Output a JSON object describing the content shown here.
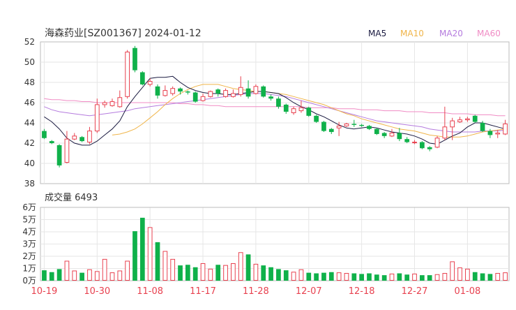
{
  "title": "海森药业[SZ001367] 2024-01-12",
  "colors": {
    "up": "#e8414f",
    "down": "#0fb14a",
    "ma5": "#1a1a40",
    "ma10": "#f0b54a",
    "ma20": "#b57bde",
    "ma60": "#f08bc4",
    "grid": "#e6e6e6",
    "frame": "#bbbbbb",
    "axis_text": "#333333",
    "date_text": "#e8414f"
  },
  "legend": {
    "ma5": "MA5",
    "ma10": "MA10",
    "ma20": "MA20",
    "ma60": "MA60"
  },
  "volume_label": "成交量 6493",
  "chart_data": [
    {
      "type": "candlestick",
      "title": "海森药业[SZ001367] 2024-01-12",
      "y_ticks": [
        52,
        50,
        48,
        46,
        44,
        42,
        40,
        38
      ],
      "ylim": [
        38,
        52
      ],
      "x_tick_labels": [
        "10-19",
        "10-30",
        "11-08",
        "11-17",
        "11-28",
        "12-07",
        "12-18",
        "12-27",
        "01-08"
      ],
      "x_tick_indices": [
        0,
        7,
        14,
        21,
        28,
        35,
        42,
        49,
        56
      ],
      "legend": [
        "MA5",
        "MA10",
        "MA20",
        "MA60"
      ],
      "candles": [
        [
          43.2,
          42.5,
          43.4,
          42.4
        ],
        [
          42.2,
          42.0,
          42.3,
          41.9
        ],
        [
          41.8,
          39.8,
          41.9,
          39.6
        ],
        [
          40.1,
          42.4,
          43.2,
          40.0
        ],
        [
          42.4,
          42.7,
          43.0,
          42.3
        ],
        [
          42.6,
          42.2,
          42.7,
          42.1
        ],
        [
          42.1,
          43.2,
          43.6,
          41.9
        ],
        [
          43.2,
          45.8,
          46.4,
          43.0
        ],
        [
          45.8,
          46.0,
          46.2,
          45.5
        ],
        [
          45.7,
          46.1,
          46.4,
          45.6
        ],
        [
          45.6,
          46.5,
          47.2,
          45.5
        ],
        [
          46.6,
          51.0,
          51.2,
          46.4
        ],
        [
          51.4,
          49.2,
          51.6,
          49.0
        ],
        [
          49.0,
          47.8,
          49.1,
          47.7
        ],
        [
          47.8,
          48.1,
          48.4,
          47.6
        ],
        [
          47.6,
          46.7,
          47.8,
          46.4
        ],
        [
          46.7,
          47.2,
          47.7,
          46.6
        ],
        [
          46.9,
          47.4,
          47.6,
          46.7
        ],
        [
          47.4,
          47.1,
          47.5,
          46.8
        ],
        [
          47.1,
          47.0,
          47.2,
          46.8
        ],
        [
          47.0,
          46.1,
          47.1,
          46.0
        ],
        [
          46.2,
          46.6,
          46.9,
          46.1
        ],
        [
          46.6,
          47.1,
          47.2,
          46.5
        ],
        [
          47.3,
          46.9,
          47.4,
          46.6
        ],
        [
          46.6,
          47.2,
          47.4,
          46.5
        ],
        [
          46.6,
          46.9,
          47.3,
          46.5
        ],
        [
          46.8,
          47.5,
          48.6,
          46.6
        ],
        [
          47.4,
          46.6,
          48.2,
          46.4
        ],
        [
          46.9,
          47.6,
          47.8,
          46.8
        ],
        [
          47.6,
          46.6,
          47.7,
          46.5
        ],
        [
          46.6,
          46.4,
          46.8,
          46.2
        ],
        [
          46.4,
          45.6,
          46.6,
          45.4
        ],
        [
          45.8,
          45.1,
          45.9,
          44.9
        ],
        [
          45.0,
          45.4,
          45.6,
          44.8
        ],
        [
          45.2,
          45.5,
          46.2,
          45.0
        ],
        [
          45.5,
          44.7,
          45.6,
          44.6
        ],
        [
          44.7,
          44.1,
          44.8,
          44.0
        ],
        [
          44.1,
          43.2,
          44.2,
          43.1
        ],
        [
          43.4,
          43.1,
          43.5,
          42.9
        ],
        [
          43.5,
          43.7,
          44.1,
          42.7
        ],
        [
          43.7,
          43.9,
          44.0,
          43.6
        ],
        [
          43.9,
          43.8,
          44.3,
          43.6
        ],
        [
          43.8,
          43.7,
          43.9,
          43.6
        ],
        [
          43.7,
          43.4,
          43.8,
          43.3
        ],
        [
          43.4,
          42.9,
          43.5,
          42.8
        ],
        [
          43.0,
          42.7,
          43.1,
          42.5
        ],
        [
          42.7,
          43.0,
          43.4,
          42.6
        ],
        [
          43.0,
          42.4,
          43.5,
          42.2
        ],
        [
          42.4,
          42.1,
          42.6,
          42.0
        ],
        [
          42.1,
          42.1,
          42.3,
          41.9
        ],
        [
          42.1,
          41.5,
          42.2,
          41.4
        ],
        [
          41.6,
          41.4,
          41.7,
          41.2
        ],
        [
          41.6,
          42.5,
          42.7,
          41.5
        ],
        [
          42.5,
          43.6,
          45.6,
          42.3
        ],
        [
          43.6,
          44.2,
          44.5,
          42.3
        ],
        [
          44.1,
          44.3,
          44.6,
          44.0
        ],
        [
          44.3,
          44.4,
          44.6,
          44.1
        ],
        [
          44.7,
          44.1,
          44.8,
          44.0
        ],
        [
          44.0,
          43.2,
          44.2,
          43.1
        ],
        [
          43.2,
          42.8,
          43.4,
          42.5
        ],
        [
          42.9,
          43.0,
          43.3,
          42.5
        ],
        [
          42.9,
          43.9,
          44.3,
          42.8
        ]
      ],
      "series": [
        {
          "name": "MA5",
          "values": [
            44.6,
            44.1,
            43.4,
            42.5,
            42.0,
            41.8,
            41.8,
            42.2,
            42.8,
            43.4,
            44.2,
            45.6,
            46.6,
            47.5,
            48.4,
            48.5,
            48.5,
            48.6,
            48.0,
            47.5,
            47.2,
            47.0,
            46.9,
            46.9,
            46.8,
            46.8,
            46.9,
            47.0,
            47.1,
            47.1,
            47.0,
            46.9,
            46.5,
            46.0,
            45.6,
            45.3,
            44.9,
            44.6,
            44.2,
            43.8,
            43.5,
            43.4,
            43.5,
            43.6,
            43.5,
            43.3,
            43.1,
            43.0,
            42.9,
            42.7,
            42.4,
            42.0,
            41.9,
            42.3,
            42.7,
            43.0,
            43.6,
            44.0,
            44.0,
            43.8,
            43.6,
            43.4
          ]
        },
        {
          "name": "MA10",
          "values": [
            null,
            null,
            null,
            null,
            null,
            null,
            null,
            null,
            null,
            42.8,
            42.9,
            43.1,
            43.4,
            43.9,
            44.5,
            45.1,
            45.8,
            46.4,
            46.9,
            47.3,
            47.6,
            47.8,
            47.8,
            47.8,
            47.6,
            47.4,
            47.3,
            47.2,
            47.1,
            47.1,
            47.0,
            46.9,
            46.8,
            46.6,
            46.4,
            46.2,
            46.0,
            45.8,
            45.5,
            45.2,
            44.9,
            44.7,
            44.4,
            44.2,
            44.0,
            43.8,
            43.6,
            43.4,
            43.3,
            43.2,
            43.0,
            42.8,
            42.7,
            42.6,
            42.6,
            42.6,
            42.7,
            42.9,
            43.1,
            43.2,
            43.3,
            43.4
          ]
        },
        {
          "name": "MA20",
          "values": [
            45.6,
            45.3,
            45.1,
            45.0,
            44.9,
            44.8,
            44.7,
            44.8,
            44.9,
            45.0,
            45.1,
            45.2,
            45.4,
            45.5,
            45.6,
            45.7,
            45.8,
            45.9,
            46.0,
            46.1,
            46.2,
            46.3,
            46.4,
            46.5,
            46.6,
            46.7,
            46.8,
            46.9,
            46.9,
            46.9,
            46.8,
            46.7,
            46.6,
            46.4,
            46.2,
            46.0,
            45.8,
            45.6,
            45.4,
            45.2,
            45.0,
            44.8,
            44.6,
            44.4,
            44.2,
            44.1,
            44.0,
            43.9,
            43.8,
            43.7,
            43.6,
            43.4,
            43.3,
            43.2,
            43.1,
            43.1,
            43.1,
            43.1,
            43.2,
            43.2,
            43.2,
            43.3
          ]
        },
        {
          "name": "MA60",
          "values": [
            46.4,
            46.3,
            46.3,
            46.2,
            46.2,
            46.1,
            46.1,
            46.0,
            46.0,
            46.0,
            46.0,
            46.0,
            46.0,
            46.0,
            46.0,
            46.0,
            46.0,
            46.0,
            45.9,
            45.9,
            45.8,
            45.8,
            45.7,
            45.7,
            45.6,
            45.6,
            45.6,
            45.6,
            45.6,
            45.6,
            45.6,
            45.6,
            45.6,
            45.6,
            45.6,
            45.5,
            45.5,
            45.5,
            45.5,
            45.4,
            45.4,
            45.4,
            45.3,
            45.3,
            45.3,
            45.2,
            45.2,
            45.2,
            45.1,
            45.1,
            45.1,
            45.0,
            45.0,
            45.0,
            44.9,
            44.9,
            44.9,
            44.8,
            44.8,
            44.8,
            44.7,
            44.7
          ]
        }
      ]
    },
    {
      "type": "bar",
      "title": "成交量 6493",
      "y_tick_labels": [
        "6万",
        "5万",
        "4万",
        "3万",
        "2万",
        "1万",
        "0万"
      ],
      "ylim": [
        0,
        60000
      ],
      "values": [
        8500,
        7000,
        9500,
        16000,
        8000,
        6500,
        9000,
        7500,
        17500,
        6500,
        8000,
        16000,
        40500,
        51500,
        43500,
        31500,
        24000,
        17500,
        12500,
        13000,
        11000,
        14000,
        9500,
        13000,
        12500,
        14000,
        23000,
        21500,
        13500,
        12500,
        11000,
        9500,
        8500,
        7000,
        9000,
        6500,
        6000,
        6500,
        7000,
        6500,
        6000,
        6000,
        5500,
        6000,
        5000,
        4500,
        5500,
        6000,
        5000,
        5500,
        4500,
        4500,
        5000,
        6000,
        15500,
        10500,
        9500,
        7000,
        6000,
        5500,
        6000,
        6493
      ]
    }
  ]
}
